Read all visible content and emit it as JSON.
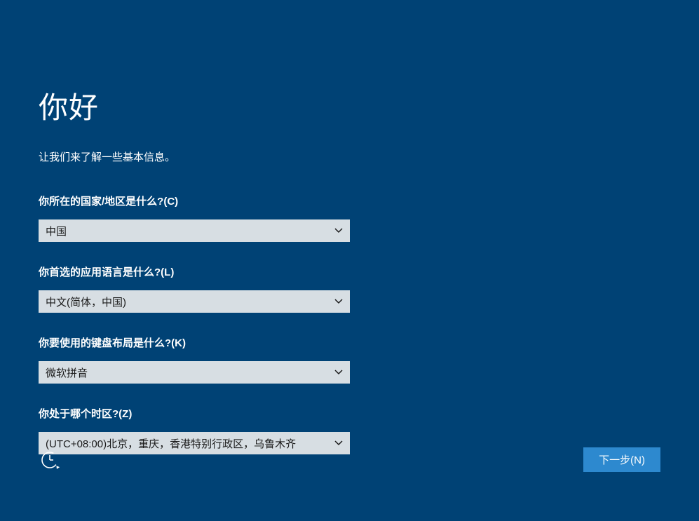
{
  "page": {
    "title": "你好",
    "subtitle": "让我们来了解一些基本信息。"
  },
  "fields": {
    "country": {
      "label": "你所在的国家/地区是什么?(C)",
      "value": "中国"
    },
    "language": {
      "label": "你首选的应用语言是什么?(L)",
      "value": "中文(简体，中国)"
    },
    "keyboard": {
      "label": "你要使用的键盘布局是什么?(K)",
      "value": "微软拼音"
    },
    "timezone": {
      "label": "你处于哪个时区?(Z)",
      "value": "(UTC+08:00)北京，重庆，香港特别行政区，乌鲁木齐"
    }
  },
  "footer": {
    "next_label": "下一步(N)"
  }
}
